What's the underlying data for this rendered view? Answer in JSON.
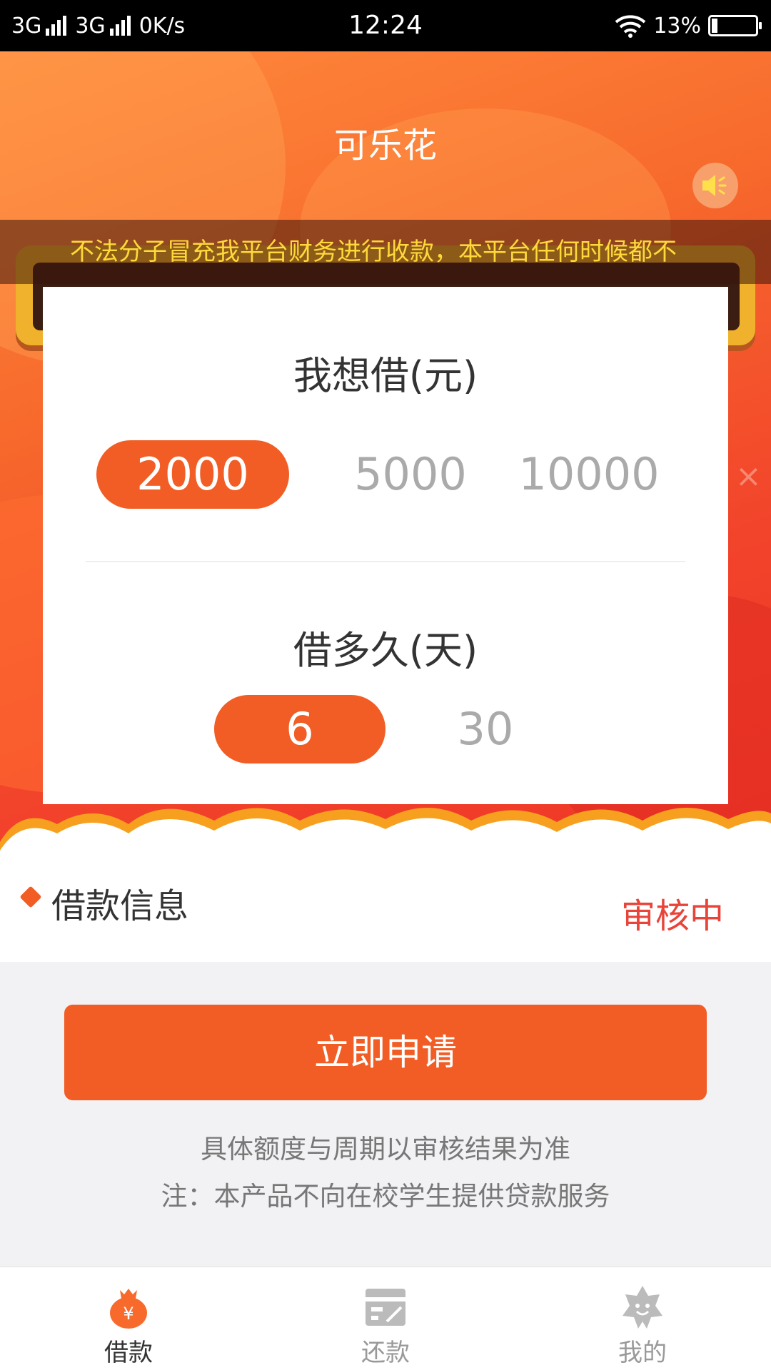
{
  "status_bar": {
    "signal1": "3G",
    "signal2": "3G",
    "speed": "0K/s",
    "time": "12:24",
    "battery": "13%",
    "battery_level": 0.13
  },
  "header": {
    "title": "可乐花",
    "speaker_icon": "speaker-icon"
  },
  "notice": {
    "text": "不法分子冒充我平台财务进行收款，本平台任何时候都不"
  },
  "card": {
    "amount_title": "我想借(元)",
    "amounts": [
      {
        "label": "2000",
        "selected": true
      },
      {
        "label": "5000",
        "selected": false
      },
      {
        "label": "10000",
        "selected": false
      }
    ],
    "duration_title": "借多久(天)",
    "durations": [
      {
        "label": "6",
        "selected": true
      },
      {
        "label": "30",
        "selected": false
      }
    ]
  },
  "loan_info": {
    "label": "借款信息",
    "status": "审核中"
  },
  "apply": {
    "button_label": "立即申请",
    "note1": "具体额度与周期以审核结果为准",
    "note2": "注：本产品不向在校学生提供贷款服务"
  },
  "tabbar": {
    "items": [
      {
        "label": "借款",
        "icon": "money-bag-icon",
        "active": true
      },
      {
        "label": "还款",
        "icon": "card-icon",
        "active": false
      },
      {
        "label": "我的",
        "icon": "smiley-flower-icon",
        "active": false
      }
    ]
  },
  "colors": {
    "accent": "#f15d24",
    "status_red": "#e8443a",
    "notice_yellow": "#ffd93a"
  }
}
